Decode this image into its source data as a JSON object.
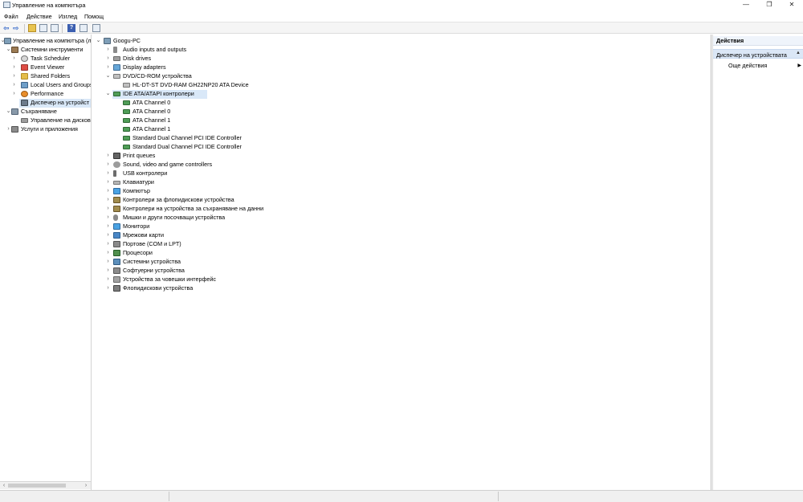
{
  "window": {
    "title": "Управление на компютъра",
    "minimize_glyph": "—",
    "maximize_glyph": "❐",
    "close_glyph": "✕"
  },
  "menu": {
    "file": "Файл",
    "action": "Действие",
    "view": "Изглед",
    "help": "Помощ"
  },
  "toolbar": {
    "back_glyph": "⇦",
    "forward_glyph": "⇨",
    "help_glyph": "?"
  },
  "left_tree": {
    "root": "Управление на компютъра (л",
    "system_tools": "Системни инструменти",
    "task_scheduler": "Task Scheduler",
    "event_viewer": "Event Viewer",
    "shared_folders": "Shared Folders",
    "local_users": "Local Users and Groups",
    "performance": "Performance",
    "device_manager": "Диспечер на устройст",
    "storage": "Съхраняване",
    "disk_management": "Управление на дисков",
    "services": "Услуги и приложения"
  },
  "device_tree": {
    "computer_name": "Googu-PC",
    "categories": [
      {
        "label": "Audio inputs and outputs",
        "icon": "audio-icon"
      },
      {
        "label": "Disk drives",
        "icon": "disk-drive-icon"
      },
      {
        "label": "Display adapters",
        "icon": "display-adapter-icon"
      },
      {
        "label": "DVD/CD-ROM устройства",
        "icon": "dvd-icon",
        "expanded": true,
        "children": [
          "HL-DT-ST DVD-RAM GH22NP20 ATA Device"
        ]
      },
      {
        "label": "IDE ATA/ATAPI контролери",
        "icon": "ide-controller-icon",
        "expanded": true,
        "selected": true,
        "children": [
          "ATA Channel 0",
          "ATA Channel 0",
          "ATA Channel 1",
          "ATA Channel 1",
          "Standard Dual Channel PCI IDE Controller",
          "Standard Dual Channel PCI IDE Controller"
        ]
      },
      {
        "label": "Print queues",
        "icon": "printer-icon"
      },
      {
        "label": "Sound, video and game controllers",
        "icon": "sound-icon"
      },
      {
        "label": "USB контролери",
        "icon": "usb-icon"
      },
      {
        "label": "Клавиатури",
        "icon": "keyboard-icon"
      },
      {
        "label": "Компютър",
        "icon": "computer-icon"
      },
      {
        "label": "Контролери за флопидискови устройства",
        "icon": "floppy-controller-icon"
      },
      {
        "label": "Контролери на устройства за съхраняване на данни",
        "icon": "storage-controller-icon"
      },
      {
        "label": "Мишки и други посочващи устройства",
        "icon": "mouse-icon"
      },
      {
        "label": "Монитори",
        "icon": "monitor-icon"
      },
      {
        "label": "Мрежови карти",
        "icon": "network-adapter-icon"
      },
      {
        "label": "Портове (COM и LPT)",
        "icon": "port-icon"
      },
      {
        "label": "Процесори",
        "icon": "processor-icon"
      },
      {
        "label": "Системни устройства",
        "icon": "system-device-icon"
      },
      {
        "label": "Софтуерни устройства",
        "icon": "software-device-icon"
      },
      {
        "label": "Устройства за човешки интерфейс",
        "icon": "hid-icon"
      },
      {
        "label": "Флопидискови устройства",
        "icon": "floppy-drive-icon"
      }
    ]
  },
  "actions": {
    "header": "Действия",
    "section": "Диспечер на устройствата",
    "more": "Още действия"
  }
}
